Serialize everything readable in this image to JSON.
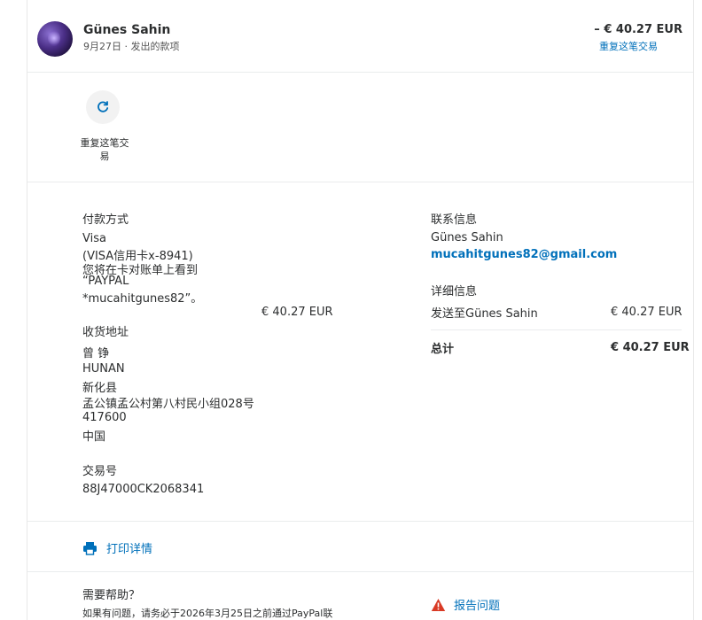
{
  "header": {
    "name": "Günes Sahin",
    "subline": "9月27日 · 发出的款项",
    "amount": "– € 40.27 EUR",
    "repeat_link": "重复这笔交易"
  },
  "actions": {
    "repeat_label": "重复这笔交易"
  },
  "payment": {
    "title": "付款方式",
    "method_lines": [
      "Visa",
      "(VISA信用卡x-8941)",
      "您将在卡对账单上看到",
      "“PAYPAL",
      "*mucahitgunes82”。"
    ],
    "amount": "€ 40.27 EUR"
  },
  "shipping": {
    "title": "收货地址",
    "lines": [
      "曾 铮",
      "HUNAN",
      "新化县",
      "孟公镇孟公村第八村民小组028号",
      "417600",
      "中国"
    ]
  },
  "transaction": {
    "title": "交易号",
    "id": "88J47000CK2068341"
  },
  "contact": {
    "title": "联系信息",
    "name": "Günes Sahin",
    "email": "mucahitgunes82@gmail.com"
  },
  "details": {
    "title": "详细信息",
    "ship_to": "发送至Günes Sahin",
    "ship_amount": "€ 40.27 EUR",
    "total_label": "总计",
    "total_amount": "€ 40.27 EUR"
  },
  "print": {
    "label": "打印详情"
  },
  "help": {
    "title": "需要帮助？",
    "text": "如果有问题，请务必于2026年3月25日之前通过PayPal联",
    "report_label": "报告问题"
  },
  "colors": {
    "link": "#0070ba",
    "alert": "#d93a25"
  }
}
